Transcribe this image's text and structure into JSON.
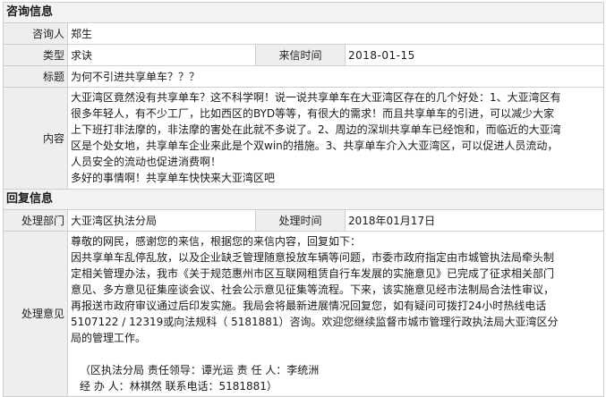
{
  "consult": {
    "section_title": "咨询信息",
    "person_label": "咨询人",
    "person": "郑生",
    "type_label": "类型",
    "type": "求诀",
    "date_label": "来信时间",
    "date": "2018-01-15",
    "title_label": "标题",
    "title": "为何不引进共享单车？？？",
    "content_label": "内容",
    "content_lines": [
      "大亚湾区竟然没有共享单车？这不科学啊！说一说共享单车在大亚湾区存在的几个好处：1、大亚湾区有",
      "很多年轻人，有不少工厂，比如西区的BYD等等，有很大的需求！而且共享单车的引进，可以减少大家",
      "上下班打非法摩的，非法摩的害处在此就不多说了。2、周边的深圳共享单车已经饱和，而临近的大亚湾",
      "区是个处女地，共享单车企业来此是个双win的措施。3、共享单车介入大亚湾区，可以促进人员流动，",
      "人员安全的流动也促进消费啊！",
      "多好的事情啊！共享单车快快来大亚湾区吧"
    ]
  },
  "reply": {
    "section_title": "回复信息",
    "dept_label": "处理部门",
    "dept": "大亚湾区执法分局",
    "date_label": "处理时间",
    "date": "2018年01月17日",
    "opinion_label": "处理意见",
    "opinion_lines": [
      "尊敬的网民，感谢您的来信，根据您的来信内容，回复如下：",
      "因共享单车乱停乱放，以及企业缺乏管理随意投放车辆等问题，市委市政府指定由市城管执法局牵头制",
      "定相关管理办法，我市《关于规范惠州市区互联网租赁自行车发展的实施意见》已完成了征求相关部门",
      "意见、多方意见征集座谈会议、社会公示意见征集等流程。下来，该实施意见经市法制局合法性审议，",
      "再报送市政府审议通过后印发实施。我局会将最新进展情况回复您，如有疑问可拨打24小时热线电话",
      "5107122 / 12319或向法规科（  5181881）咨询。欢迎您继续监督市城市管理行政执法局大亚湾区分",
      "局的管理工作。"
    ],
    "sign_lines": [
      "（区执法分局  责任领导：谭光运  责  任  人：李统洲",
      "  经  办  人：林祺然  联系电话：5181881）"
    ]
  }
}
